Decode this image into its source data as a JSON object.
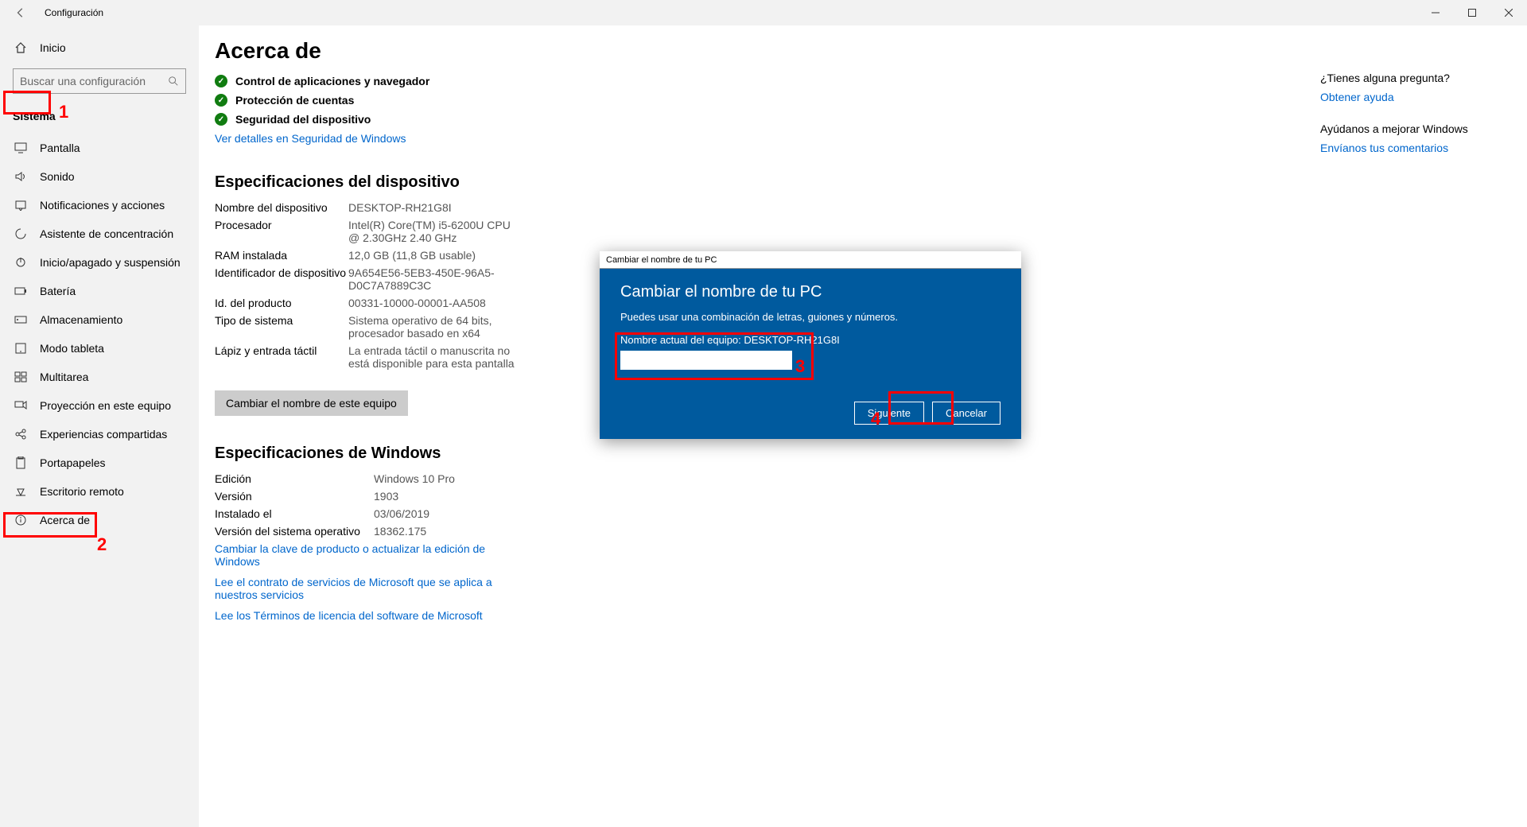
{
  "titlebar": {
    "title": "Configuración"
  },
  "sidebar": {
    "home": "Inicio",
    "search_placeholder": "Buscar una configuración",
    "group": "Sistema",
    "items": [
      {
        "label": "Pantalla"
      },
      {
        "label": "Sonido"
      },
      {
        "label": "Notificaciones y acciones"
      },
      {
        "label": "Asistente de concentración"
      },
      {
        "label": "Inicio/apagado y suspensión"
      },
      {
        "label": "Batería"
      },
      {
        "label": "Almacenamiento"
      },
      {
        "label": "Modo tableta"
      },
      {
        "label": "Multitarea"
      },
      {
        "label": "Proyección en este equipo"
      },
      {
        "label": "Experiencias compartidas"
      },
      {
        "label": "Portapapeles"
      },
      {
        "label": "Escritorio remoto"
      },
      {
        "label": "Acerca de"
      }
    ]
  },
  "main": {
    "title": "Acerca de",
    "security": [
      "Control de aplicaciones y navegador",
      "Protección de cuentas",
      "Seguridad del dispositivo"
    ],
    "security_link": "Ver detalles en Seguridad de Windows",
    "device_spec_title": "Especificaciones del dispositivo",
    "device_specs": [
      {
        "label": "Nombre del dispositivo",
        "value": "DESKTOP-RH21G8I"
      },
      {
        "label": "Procesador",
        "value": "Intel(R) Core(TM) i5-6200U CPU @ 2.30GHz   2.40 GHz"
      },
      {
        "label": "RAM instalada",
        "value": "12,0 GB (11,8 GB usable)"
      },
      {
        "label": "Identificador de dispositivo",
        "value": "9A654E56-5EB3-450E-96A5-D0C7A7889C3C"
      },
      {
        "label": "Id. del producto",
        "value": "00331-10000-00001-AA508"
      },
      {
        "label": "Tipo de sistema",
        "value": "Sistema operativo de 64 bits, procesador basado en x64"
      },
      {
        "label": "Lápiz y entrada táctil",
        "value": "La entrada táctil o manuscrita no está disponible para esta pantalla"
      }
    ],
    "rename_button": "Cambiar el nombre de este equipo",
    "windows_spec_title": "Especificaciones de Windows",
    "windows_specs": [
      {
        "label": "Edición",
        "value": "Windows 10 Pro"
      },
      {
        "label": "Versión",
        "value": "1903"
      },
      {
        "label": "Instalado el",
        "value": "03/06/2019"
      },
      {
        "label": "Versión del sistema operativo",
        "value": "18362.175"
      }
    ],
    "links": [
      "Cambiar la clave de producto o actualizar la edición de Windows",
      "Lee el contrato de servicios de Microsoft que se aplica a nuestros servicios",
      "Lee los Términos de licencia del software de Microsoft"
    ]
  },
  "right": {
    "question": "¿Tienes alguna pregunta?",
    "get_help": "Obtener ayuda",
    "improve": "Ayúdanos a mejorar Windows",
    "feedback": "Envíanos tus comentarios"
  },
  "dialog": {
    "window_title": "Cambiar el nombre de tu PC",
    "heading": "Cambiar el nombre de tu PC",
    "sub": "Puedes usar una combinación de letras, guiones y números.",
    "current_label": "Nombre actual del equipo: DESKTOP-RH21G8I",
    "next": "Siguiente",
    "cancel": "Cancelar"
  },
  "annotations": {
    "n1": "1",
    "n2": "2",
    "n3": "3",
    "n4": "4"
  }
}
